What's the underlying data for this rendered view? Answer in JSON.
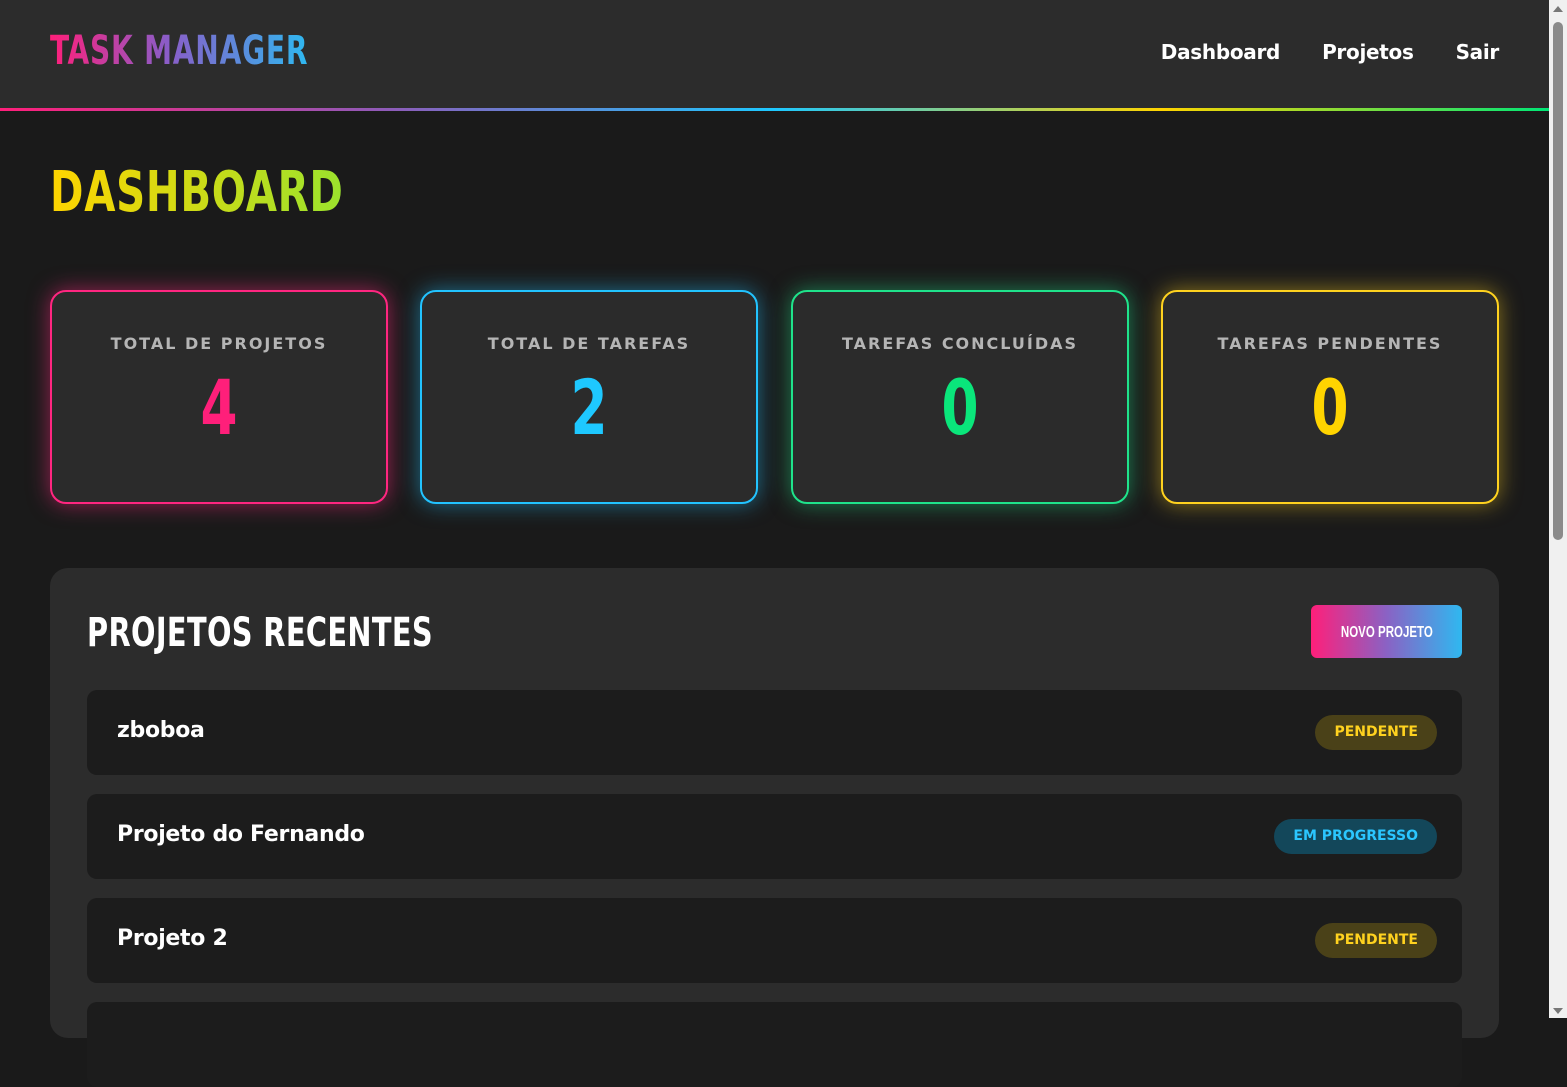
{
  "navbar": {
    "brand": "TASK MANAGER",
    "links": [
      "Dashboard",
      "Projetos",
      "Sair"
    ]
  },
  "page": {
    "title": "DASHBOARD"
  },
  "stats": [
    {
      "label": "TOTAL DE PROJETOS",
      "value": "4",
      "color": "#ff1f7a"
    },
    {
      "label": "TOTAL DE TAREFAS",
      "value": "2",
      "color": "#1ec8ff"
    },
    {
      "label": "TAREFAS CONCLUÍDAS",
      "value": "0",
      "color": "#0ae67b"
    },
    {
      "label": "TAREFAS PENDENTES",
      "value": "0",
      "color": "#ffd400"
    }
  ],
  "projects": {
    "title": "PROJETOS RECENTES",
    "new_button": "NOVO PROJETO",
    "items": [
      {
        "name": "zboboa",
        "status": "PENDENTE"
      },
      {
        "name": "Projeto do Fernando",
        "status": "EM PROGRESSO"
      },
      {
        "name": "Projeto 2",
        "status": "PENDENTE"
      }
    ]
  },
  "colors": {
    "background": "#1a1a1a",
    "panel": "#2c2c2c",
    "pink": "#ff1f7a",
    "blue": "#1ec8ff",
    "green": "#0ae67b",
    "yellow": "#ffd400"
  }
}
